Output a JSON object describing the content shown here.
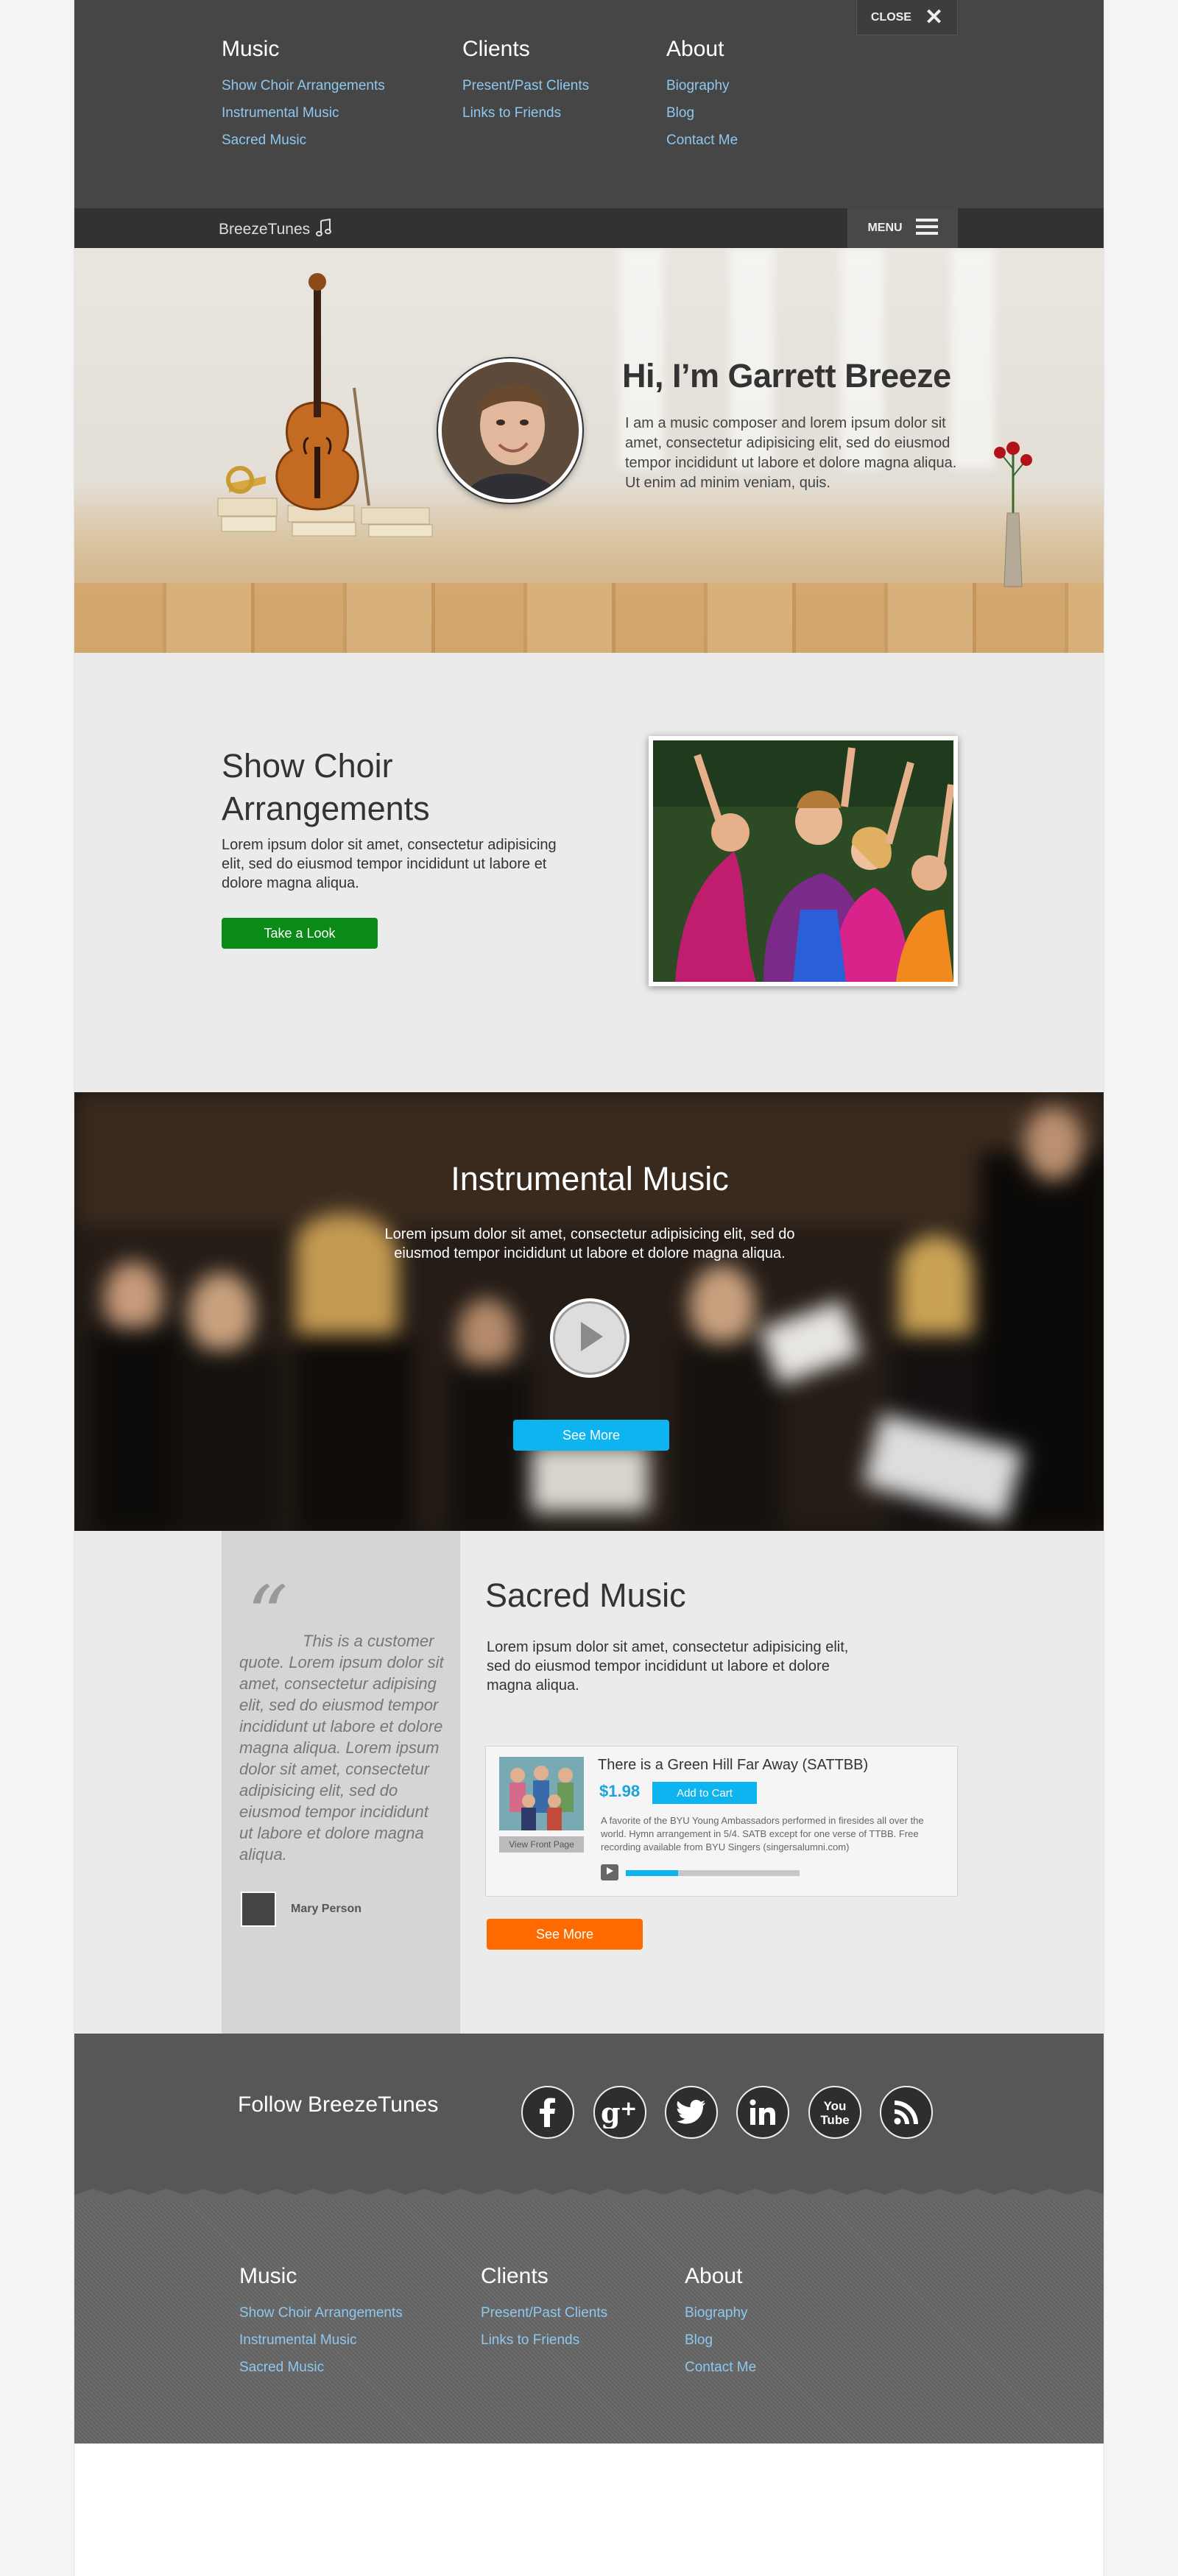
{
  "top_menu": {
    "close_label": "CLOSE",
    "columns": [
      {
        "heading": "Music",
        "links": [
          "Show Choir Arrangements",
          "Instrumental Music",
          "Sacred Music"
        ]
      },
      {
        "heading": "Clients",
        "links": [
          "Present/Past Clients",
          "Links to Friends"
        ]
      },
      {
        "heading": "About",
        "links": [
          "Biography",
          "Blog",
          "Contact Me"
        ]
      }
    ]
  },
  "navbar": {
    "brand": "BreezeTunes",
    "menu_label": "MENU"
  },
  "hero": {
    "title": "Hi, I’m Garrett Breeze",
    "text": "I am a music composer and lorem ipsum dolor sit amet, consectetur adipisicing elit, sed do eiusmod tempor incididunt ut labore et dolore magna aliqua. Ut enim ad minim veniam, quis."
  },
  "choir": {
    "title": "Show Choir Arrangements",
    "text": "Lorem ipsum dolor sit amet, consectetur adipisicing elit, sed do eiusmod tempor incididunt ut labore et dolore magna aliqua.",
    "button": "Take a Look"
  },
  "instrumental": {
    "title": "Instrumental Music",
    "text": "Lorem ipsum dolor sit amet, consectetur adipisicing elit, sed do eiusmod tempor incididunt ut labore et dolore magna aliqua.",
    "button": "See More"
  },
  "sacred": {
    "quote": "This is a customer quote. Lorem ipsum dolor sit amet, consectetur adipising elit, sed do eiusmod tempor incididunt ut labore et dolore magna aliqua. Lorem ipsum dolor sit amet, consectetur adipisicing elit, sed do eiusmod tempor incididunt ut labore et dolore magna aliqua.",
    "quote_author": "Mary Person",
    "title": "Sacred Music",
    "text": "Lorem ipsum dolor sit amet, consectetur adipisicing elit, sed do eiusmod tempor incididunt ut labore et dolore magna aliqua.",
    "product": {
      "title": "There is a Green Hill Far Away (SATTBB)",
      "price": "$1.98",
      "add_to_cart": "Add to Cart",
      "view_front_page": "View Front Page",
      "description": "A favorite of the BYU Young Ambassadors performed in firesides all over the world. Hymn arrangement in 5/4. SATB except for one verse of TTBB. Free recording available from BYU Singers (singersalumni.com)",
      "progress": 0.3
    },
    "button": "See More"
  },
  "footer": {
    "follow_title": "Follow BreezeTunes",
    "social": [
      "facebook-icon",
      "google-plus-icon",
      "twitter-icon",
      "linkedin-icon",
      "youtube-icon",
      "rss-icon"
    ],
    "columns": [
      {
        "heading": "Music",
        "links": [
          "Show Choir Arrangements",
          "Instrumental Music",
          "Sacred Music"
        ]
      },
      {
        "heading": "Clients",
        "links": [
          "Present/Past Clients",
          "Links to Friends"
        ]
      },
      {
        "heading": "About",
        "links": [
          "Biography",
          "Blog",
          "Contact Me"
        ]
      }
    ]
  },
  "colors": {
    "green": "#0a8a16",
    "blue": "#0db4f0",
    "orange": "#ff6a00",
    "link": "#8ec8ef"
  }
}
